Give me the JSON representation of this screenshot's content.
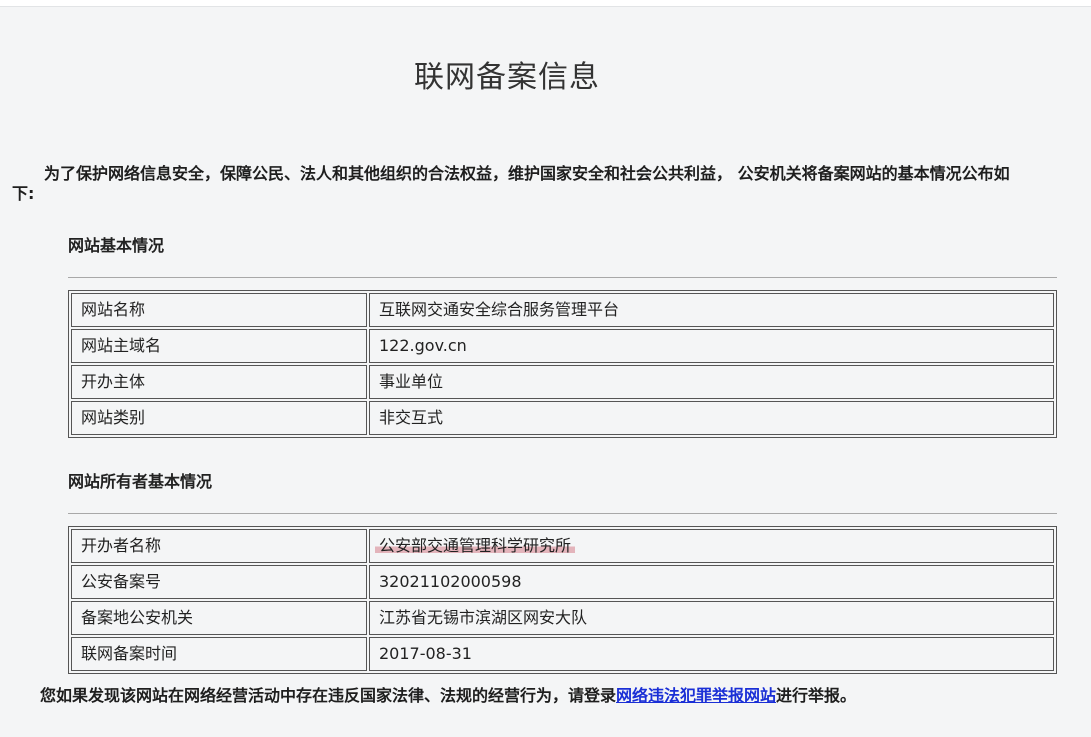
{
  "title": "联网备案信息",
  "intro": {
    "line1": "为了保护网络信息安全，保障公民、法人和其他组织的合法权益，维护国家安全和社会公共利益， 公安机关将备案网站的基本情况公布如",
    "line2": "下:"
  },
  "website_section": {
    "heading": "网站基本情况",
    "rows": [
      {
        "label": "网站名称",
        "value": "互联网交通安全综合服务管理平台"
      },
      {
        "label": "网站主域名",
        "value": "122.gov.cn"
      },
      {
        "label": "开办主体",
        "value": "事业单位"
      },
      {
        "label": "网站类别",
        "value": "非交互式"
      }
    ]
  },
  "owner_section": {
    "heading": "网站所有者基本情况",
    "rows": [
      {
        "label": "开办者名称",
        "value": "公安部交通管理科学研究所"
      },
      {
        "label": "公安备案号",
        "value": "32021102000598"
      },
      {
        "label": "备案地公安机关",
        "value": "江苏省无锡市滨湖区网安大队"
      },
      {
        "label": "联网备案时间",
        "value": "2017-08-31"
      }
    ]
  },
  "footer": {
    "before": "您如果发现该网站在网络经营活动中存在违反国家法律、法规的经营行为，请登录",
    "link": "网络违法犯罪举报网站",
    "after": "进行举报。"
  },
  "colors": {
    "background": "#f4f5f6",
    "link": "#1a2fd6",
    "highlight": "#e3b4bb"
  }
}
